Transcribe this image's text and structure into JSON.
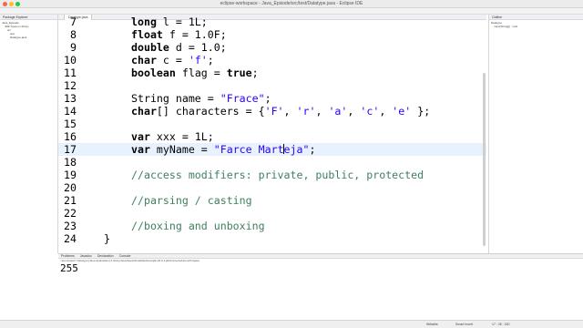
{
  "window": {
    "title": "eclipse-workspace - Java_Episode/src/test/Datatype.java - Eclipse IDE"
  },
  "package_explorer": {
    "tab_label": "Package Explorer",
    "items": [
      "Java_Episode",
      "JRE System Library",
      "src",
      "test",
      "Datatype.java"
    ]
  },
  "editor": {
    "tab_label": "Datatype.java",
    "lines": [
      {
        "num": "7",
        "parts": [
          {
            "t": "kw",
            "v": "long"
          },
          {
            "t": "pl",
            "v": " l = 1L;"
          }
        ]
      },
      {
        "num": "8",
        "parts": [
          {
            "t": "kw",
            "v": "float"
          },
          {
            "t": "pl",
            "v": " f = 1.0F;"
          }
        ]
      },
      {
        "num": "9",
        "parts": [
          {
            "t": "kw",
            "v": "double"
          },
          {
            "t": "pl",
            "v": " d = 1.0;"
          }
        ]
      },
      {
        "num": "10",
        "parts": [
          {
            "t": "kw",
            "v": "char"
          },
          {
            "t": "pl",
            "v": " c = "
          },
          {
            "t": "str",
            "v": "'f'"
          },
          {
            "t": "pl",
            "v": ";"
          }
        ]
      },
      {
        "num": "11",
        "parts": [
          {
            "t": "kw",
            "v": "boolean"
          },
          {
            "t": "pl",
            "v": " flag = "
          },
          {
            "t": "kw",
            "v": "true"
          },
          {
            "t": "pl",
            "v": ";"
          }
        ]
      },
      {
        "num": "12",
        "parts": []
      },
      {
        "num": "13",
        "parts": [
          {
            "t": "pl",
            "v": "String name = "
          },
          {
            "t": "str",
            "v": "\"Frace\""
          },
          {
            "t": "pl",
            "v": ";"
          }
        ]
      },
      {
        "num": "14",
        "parts": [
          {
            "t": "kw",
            "v": "char"
          },
          {
            "t": "pl",
            "v": "[] characters = {"
          },
          {
            "t": "str",
            "v": "'F'"
          },
          {
            "t": "pl",
            "v": ", "
          },
          {
            "t": "str",
            "v": "'r'"
          },
          {
            "t": "pl",
            "v": ", "
          },
          {
            "t": "str",
            "v": "'a'"
          },
          {
            "t": "pl",
            "v": ", "
          },
          {
            "t": "str",
            "v": "'c'"
          },
          {
            "t": "pl",
            "v": ", "
          },
          {
            "t": "str",
            "v": "'e'"
          },
          {
            "t": "pl",
            "v": " };"
          }
        ]
      },
      {
        "num": "15",
        "parts": []
      },
      {
        "num": "16",
        "parts": [
          {
            "t": "kw",
            "v": "var"
          },
          {
            "t": "pl",
            "v": " xxx = 1L;"
          }
        ]
      },
      {
        "num": "17",
        "current": true,
        "parts": [
          {
            "t": "kw",
            "v": "var"
          },
          {
            "t": "pl",
            "v": " myName = "
          },
          {
            "t": "str",
            "v": "\"Farce Mart"
          },
          {
            "t": "caret",
            "v": ""
          },
          {
            "t": "str",
            "v": "eja\""
          },
          {
            "t": "pl",
            "v": ";"
          }
        ]
      },
      {
        "num": "18",
        "parts": []
      },
      {
        "num": "19",
        "parts": [
          {
            "t": "cm",
            "v": "//access modifiers: private, public, protected"
          }
        ]
      },
      {
        "num": "20",
        "parts": []
      },
      {
        "num": "21",
        "parts": [
          {
            "t": "cm",
            "v": "//parsing / casting"
          }
        ]
      },
      {
        "num": "22",
        "parts": []
      },
      {
        "num": "23",
        "parts": [
          {
            "t": "cm",
            "v": "//boxing and unboxing"
          }
        ]
      },
      {
        "num": "24",
        "closing": true,
        "parts": [
          {
            "t": "pl",
            "v": "}"
          }
        ]
      }
    ]
  },
  "outline": {
    "tab_label": "Outline",
    "items": [
      "Datatype",
      "main(String[]) : void"
    ]
  },
  "console": {
    "tabs": [
      "Problems",
      "Javadoc",
      "Declaration",
      "Console"
    ],
    "header": "<terminated> Datatype [Java Application] /Library/Java/JavaVirtualMachines/jdk-18.0.1.jdk/Contents/Home/bin/java",
    "output": "255"
  },
  "statusbar": {
    "mode": "Writable",
    "insert": "Smart Insert",
    "position": "17 : 35 : 320"
  }
}
